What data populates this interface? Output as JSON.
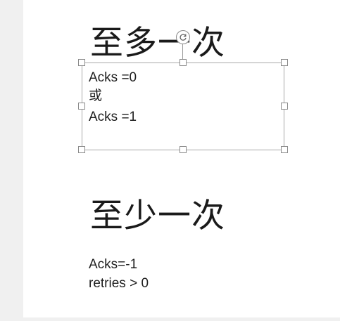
{
  "slide": {
    "heading_top": "至多一次",
    "box_lines": [
      "Acks =0",
      "或",
      "Acks =1"
    ],
    "heading_bottom": "至少一次",
    "bottom_lines": [
      "Acks=-1",
      "retries > 0"
    ]
  },
  "icons": {
    "rotate": "rotate-icon"
  }
}
